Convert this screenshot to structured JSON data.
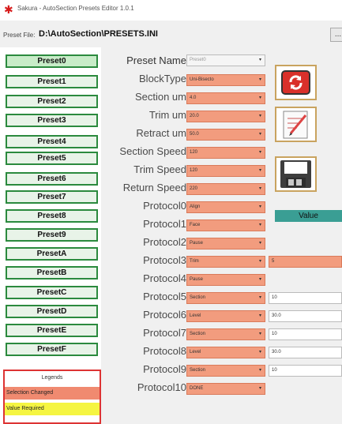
{
  "window": {
    "title": "Sakura - AutoSection Presets Editor 1.0.1"
  },
  "file": {
    "label": "Preset File:",
    "path": "D:\\AutoSection\\PRESETS.INI",
    "browse_label": "..."
  },
  "presets": [
    "Preset0",
    "Preset1",
    "Preset2",
    "Preset3",
    "Preset4",
    "Preset5",
    "Preset6",
    "Preset7",
    "Preset8",
    "Preset9",
    "PresetA",
    "PresetB",
    "PresetC",
    "PresetD",
    "PresetE",
    "PresetF"
  ],
  "legend": {
    "title": "Legends",
    "changed": "Selection Changed",
    "required": "Value Required"
  },
  "value_header": "Value",
  "colors": {
    "changed": "#f29c7e",
    "required": "#f5f542",
    "preset_border": "#2b8a3e",
    "value_header": "#3a9e94"
  },
  "icons": [
    "reload-icon",
    "edit-icon",
    "save-icon"
  ],
  "rows": [
    {
      "label": "Preset Name",
      "value": "Preset0",
      "extra": null
    },
    {
      "label": "BlockType",
      "value": "Uni-Bisecto",
      "extra": null
    },
    {
      "label": "Section um",
      "value": "4.0",
      "extra": null
    },
    {
      "label": "Trim um",
      "value": "20.0",
      "extra": null
    },
    {
      "label": "Retract um",
      "value": "50.0",
      "extra": null
    },
    {
      "label": "Section Speed",
      "value": "120",
      "extra": null
    },
    {
      "label": "Trim Speed",
      "value": "120",
      "extra": null
    },
    {
      "label": "Return Speed",
      "value": "220",
      "extra": null
    },
    {
      "label": "Protocol0",
      "value": "Align",
      "extra": null
    },
    {
      "label": "Protocol1",
      "value": "Face",
      "extra": null
    },
    {
      "label": "Protocol2",
      "value": "Pause",
      "extra": null
    },
    {
      "label": "Protocol3",
      "value": "Trim",
      "extra": "5"
    },
    {
      "label": "Protocol4",
      "value": "Pause",
      "extra": null
    },
    {
      "label": "Protocol5",
      "value": "Section",
      "extra": "10"
    },
    {
      "label": "Protocol6",
      "value": "Level",
      "extra": "30.0"
    },
    {
      "label": "Protocol7",
      "value": "Section",
      "extra": "10"
    },
    {
      "label": "Protocol8",
      "value": "Level",
      "extra": "30.0"
    },
    {
      "label": "Protocol9",
      "value": "Section",
      "extra": "10"
    },
    {
      "label": "Protocol10",
      "value": "DONE",
      "extra": null
    }
  ]
}
